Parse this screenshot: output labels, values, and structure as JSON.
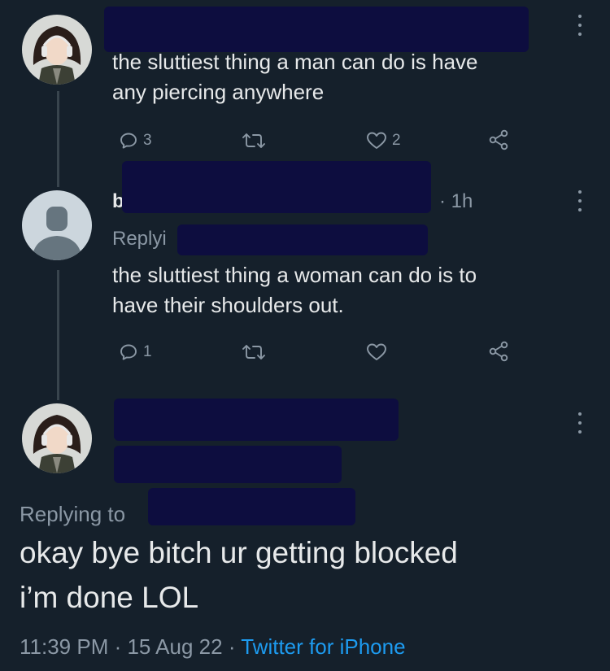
{
  "tweet1": {
    "text": "the sluttiest thing a man can do is have\nany piercing anywhere",
    "replies": "3",
    "retweets": "",
    "likes": "2"
  },
  "tweet2": {
    "name_partial": "b",
    "time": "· 1h",
    "replying_partial": "Replyi",
    "text": "the sluttiest thing a woman can do is to\nhave their shoulders out.",
    "replies": "1",
    "retweets": "",
    "likes": ""
  },
  "tweet3": {
    "replying_label": "Replying to",
    "text": "okay bye bitch ur getting blocked\ni’m done LOL",
    "time": "11:39 PM",
    "date": "15 Aug 22",
    "source": "Twitter for iPhone",
    "separator": " · "
  },
  "icons": {
    "reply": "reply-icon",
    "retweet": "retweet-icon",
    "like": "heart-icon",
    "share": "share-icon",
    "more": "more-icon"
  },
  "colors": {
    "background": "#15202b",
    "text": "#e7e9ea",
    "muted": "#8b98a5",
    "link": "#1d9bf0",
    "redaction": "#0d0d3f"
  }
}
